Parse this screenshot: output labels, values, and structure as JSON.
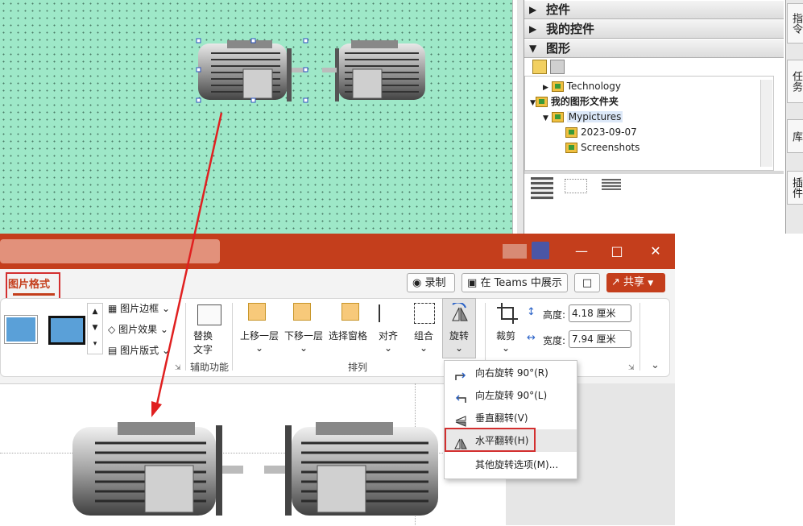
{
  "panel": {
    "sections": [
      {
        "label": "控件",
        "expanded": false
      },
      {
        "label": "我的控件",
        "expanded": false
      },
      {
        "label": "图形",
        "expanded": true
      }
    ],
    "tree": [
      {
        "label": "Technology"
      },
      {
        "label": "我的图形文件夹"
      },
      {
        "label": "Mypictures"
      },
      {
        "label": "2023-09-07"
      },
      {
        "label": "Screenshots"
      }
    ],
    "side_tabs": [
      "指令",
      "任务",
      "库",
      "插件"
    ]
  },
  "ppt": {
    "active_tab": "图片格式",
    "record_label": "录制",
    "teams_label": "在 Teams 中展示",
    "share_label": "共享",
    "ribbon": {
      "picture_border": "图片边框",
      "picture_effects": "图片效果",
      "picture_layout": "图片版式",
      "alt_text": [
        "替换",
        "文字"
      ],
      "bring_forward": "上移一层",
      "send_backward": "下移一层",
      "selection_pane": "选择窗格",
      "align": "对齐",
      "group": "组合",
      "rotate": "旋转",
      "crop": "裁剪",
      "height_label": "高度:",
      "height_value": "4.18 厘米",
      "width_label": "宽度:",
      "width_value": "7.94 厘米",
      "group_accessibility": "辅助功能",
      "group_arrange": "排列"
    },
    "rotate_menu": [
      {
        "label": "向右旋转 90°(R)",
        "icon": "rotate-right-icon"
      },
      {
        "label": "向左旋转 90°(L)",
        "icon": "rotate-left-icon"
      },
      {
        "label": "垂直翻转(V)",
        "icon": "flip-vertical-icon"
      },
      {
        "label": "水平翻转(H)",
        "icon": "flip-horizontal-icon"
      },
      {
        "label": "其他旋转选项(M)...",
        "icon": ""
      }
    ]
  },
  "colors": {
    "ppt_accent": "#c43e1c",
    "canvas_bg": "#9ee8c8",
    "highlight_red": "#d32f2f"
  }
}
